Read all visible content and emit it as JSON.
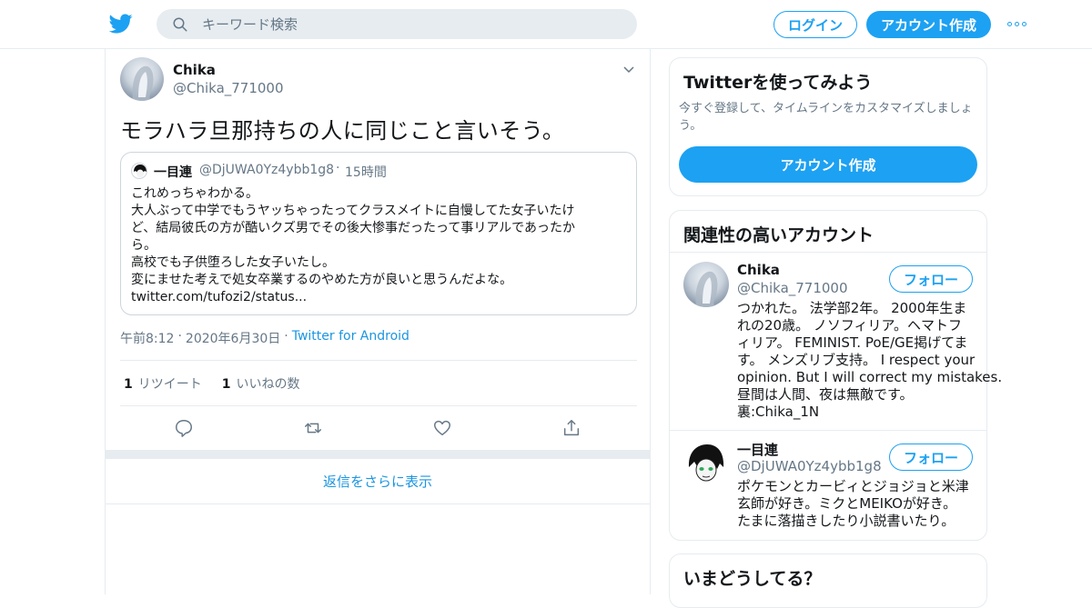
{
  "header": {
    "search_placeholder": "キーワード検索",
    "login_label": "ログイン",
    "signup_label": "アカウント作成",
    "brand_color": "#1da1f2"
  },
  "tweet": {
    "author_name": "Chika",
    "author_handle": "@Chika_771000",
    "text": "モラハラ旦那持ちの人に同じこと言いそう。",
    "quote": {
      "name": "一目連",
      "handle": "@DjUWA0Yz4ybb1g8",
      "time": "15時間",
      "lines": [
        "これめっちゃわかる。",
        "大人ぶって中学でもうヤッちゃったってクラスメイトに自慢してた女子いたけ",
        "ど、結局彼氏の方が酷いクズ男でその後大惨事だったって事リアルであったか",
        "ら。",
        "高校でも子供堕ろした女子いたし。",
        "変にませた考えで処女卒業するのやめた方が良いと思うんだよな。",
        "twitter.com/tufozi2/status..."
      ]
    },
    "time": "午前8:12",
    "date": "2020年6月30日",
    "source": "Twitter for Android",
    "retweet_count": "1",
    "retweet_label": "リツイート",
    "like_count": "1",
    "like_label": "いいねの数"
  },
  "more_replies_label": "返信をさらに表示",
  "sidebar": {
    "signup_card": {
      "title": "Twitterを使ってみよう",
      "description": "今すぐ登録して、タイムラインをカスタマイズしましょう。",
      "button_label": "アカウント作成"
    },
    "related": {
      "title": "関連性の高いアカウント",
      "follow_label": "フォロー",
      "accounts": [
        {
          "name": "Chika",
          "handle": "@Chika_771000",
          "bio_lines": [
            "つかれた。 法学部2年。 2000年生ま",
            "れの20歳。 ノソフィリア。ヘマトフ",
            "ィリア。 FEMINIST. PoE/GE掲げてま",
            "す。 メンズリブ支持。 I respect your",
            "opinion. But I will correct my mistakes.",
            "昼間は人間、夜は無敵です。",
            "裏:Chika_1N"
          ]
        },
        {
          "name": "一目連",
          "handle": "@DjUWA0Yz4ybb1g8",
          "bio_lines": [
            "ポケモンとカービィとジョジョと米津",
            "玄師が好き。ミクとMEIKOが好き。",
            "たまに落描きしたり小説書いたり。"
          ]
        }
      ]
    },
    "trends_title": "いまどうしてる？"
  }
}
